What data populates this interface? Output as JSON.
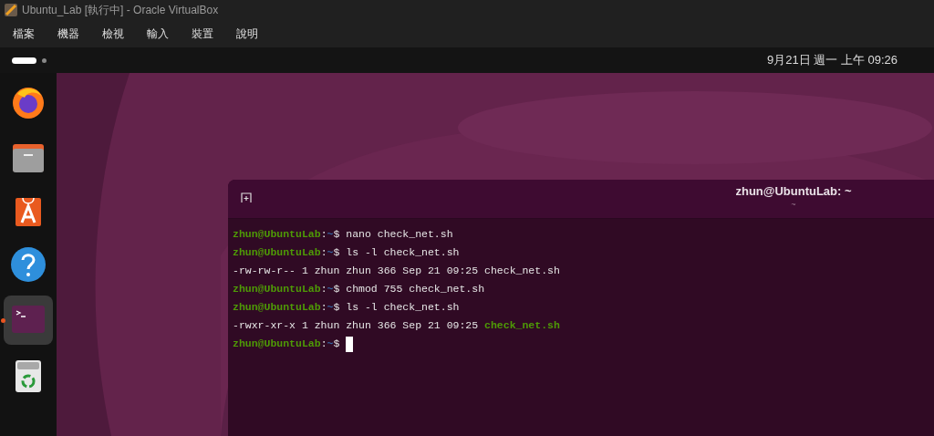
{
  "window": {
    "title": "Ubuntu_Lab [執行中] - Oracle VirtualBox"
  },
  "menu": [
    "檔案",
    "機器",
    "檢視",
    "輸入",
    "裝置",
    "說明"
  ],
  "top_panel": {
    "clock": "9月21日 週一 上午 09:26"
  },
  "dock": [
    {
      "kind": "browser",
      "selected": false
    },
    {
      "kind": "files",
      "selected": false
    },
    {
      "kind": "store",
      "selected": false
    },
    {
      "kind": "help",
      "selected": false
    },
    {
      "kind": "terminal",
      "selected": true
    },
    {
      "kind": "trash",
      "selected": false
    }
  ],
  "terminal": {
    "title": "zhun@UbuntuLab: ~",
    "subtitle": "~",
    "lines": [
      {
        "kind": "prompt",
        "user": "zhun@UbuntuLab",
        "separator": ":",
        "path": "~",
        "sign": "$",
        "command": "nano check_net.sh"
      },
      {
        "kind": "prompt",
        "user": "zhun@UbuntuLab",
        "separator": ":",
        "path": "~",
        "sign": "$",
        "command": "ls -l check_net.sh"
      },
      {
        "kind": "output",
        "text": "-rw-rw-r-- 1 zhun zhun 366 Sep 21 09:25 ",
        "file": "check_net.sh",
        "executable": false
      },
      {
        "kind": "prompt",
        "user": "zhun@UbuntuLab",
        "separator": ":",
        "path": "~",
        "sign": "$",
        "command": "chmod 755 check_net.sh"
      },
      {
        "kind": "prompt",
        "user": "zhun@UbuntuLab",
        "separator": ":",
        "path": "~",
        "sign": "$",
        "command": "ls -l check_net.sh"
      },
      {
        "kind": "output",
        "text": "-rwxr-xr-x 1 zhun zhun 366 Sep 21 09:25 ",
        "file": "check_net.sh",
        "executable": true
      },
      {
        "kind": "prompt",
        "user": "zhun@UbuntuLab",
        "separator": ":",
        "path": "~",
        "sign": "$",
        "cursor": true
      }
    ]
  }
}
